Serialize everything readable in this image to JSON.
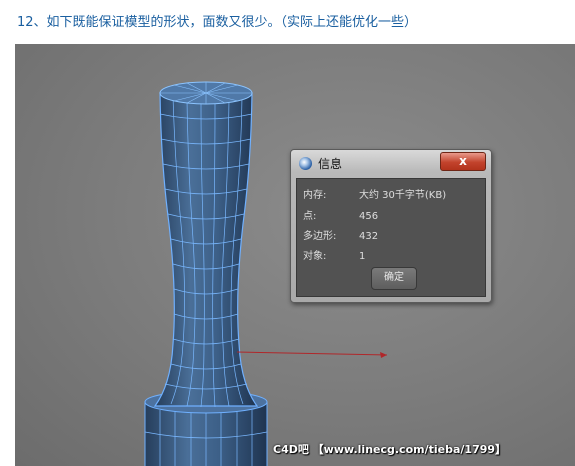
{
  "caption": "12、如下既能保证模型的形状，面数又很少。（实际上还能优化一些）",
  "dialog": {
    "title": "信息",
    "close_label": "x",
    "rows": [
      {
        "label": "内存:",
        "value": "大约 30千字节(KB)"
      },
      {
        "label": "点:",
        "value": "456"
      },
      {
        "label": "多边形:",
        "value": "432"
      },
      {
        "label": "对象:",
        "value": "1"
      }
    ],
    "ok_label": "确定"
  },
  "watermark": "C4D吧 【www.linecg.com/tieba/1799】",
  "colors": {
    "viewport_bg": "#7b7b7b",
    "wireframe": "#5aa0ff",
    "model_shade": "#3e5f86",
    "arrow": "#b0272a",
    "caption_text": "#1a5fa0"
  },
  "icons": {
    "dialog_icon": "cinema4d-logo-icon",
    "close": "close-icon"
  }
}
